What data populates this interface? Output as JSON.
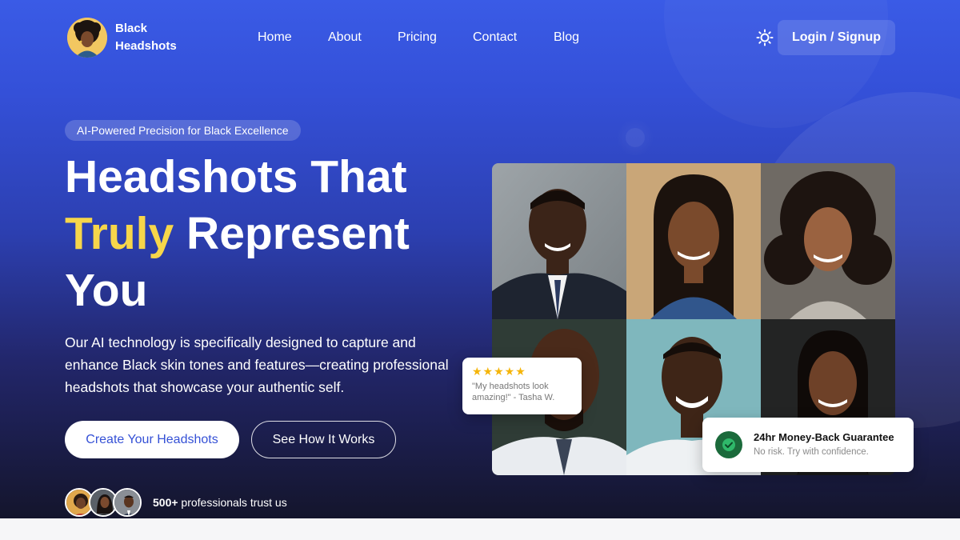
{
  "brand": {
    "name_line1": "Black",
    "name_line2": "Headshots",
    "logo_icon": "woman-avatar-logo"
  },
  "nav": {
    "items": [
      {
        "label": "Home"
      },
      {
        "label": "About"
      },
      {
        "label": "Pricing"
      },
      {
        "label": "Contact"
      },
      {
        "label": "Blog"
      }
    ],
    "theme_toggle_icon": "sun-icon",
    "login_label": "Login / Signup"
  },
  "hero": {
    "badge": "AI-Powered Precision for Black Excellence",
    "headline_line1": "Headshots That",
    "headline_accent": "Truly",
    "headline_line2_rest": " Represent",
    "headline_line3": "You",
    "description": "Our AI technology is specifically designed to capture and enhance Black skin tones and features—creating professional headshots that showcase your authentic self.",
    "primary_cta": "Create Your Headshots",
    "secondary_cta": "See How It Works",
    "trust_count": "500+",
    "trust_text": " professionals trust us"
  },
  "review": {
    "stars": "★★★★★",
    "quote": "\"My headshots look amazing!\" - Tasha W."
  },
  "guarantee": {
    "title": "24hr Money-Back Guarantee",
    "subtitle": "No risk. Try with confidence.",
    "icon": "check-circle-icon"
  },
  "colors": {
    "accent": "#f7d64a",
    "primary_blue": "#3551d6",
    "guarantee_green": "#1b6a3b",
    "star_color": "#f5b50a"
  }
}
